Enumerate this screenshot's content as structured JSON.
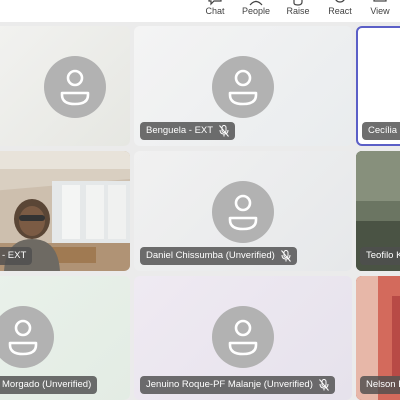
{
  "toolbar": {
    "chat_label": "Chat",
    "people_label": "People",
    "raise_label": "Raise",
    "react_label": "React",
    "view_label": "View"
  },
  "participants": {
    "p_top_left": {
      "name": ""
    },
    "p_benguela": {
      "name": "Benguela - EXT"
    },
    "p_cecilia": {
      "name": "Cecília K"
    },
    "p_ext_video": {
      "name": "- EXT"
    },
    "p_daniel": {
      "name": "Daniel Chissumba (Unverified)"
    },
    "p_teofilo": {
      "name": "Teofilo K"
    },
    "p_morgado": {
      "name": "Morgado (Unverified)"
    },
    "p_jenuino": {
      "name": "Jenuino Roque-PF Malanje (Unverified)"
    },
    "p_nelson": {
      "name": "Nelson R"
    }
  },
  "colors": {
    "accent_selected_border": "#5b5fc7",
    "avatar_bg": "#b2b2b2",
    "name_tag_bg": "#4e4e4e"
  }
}
